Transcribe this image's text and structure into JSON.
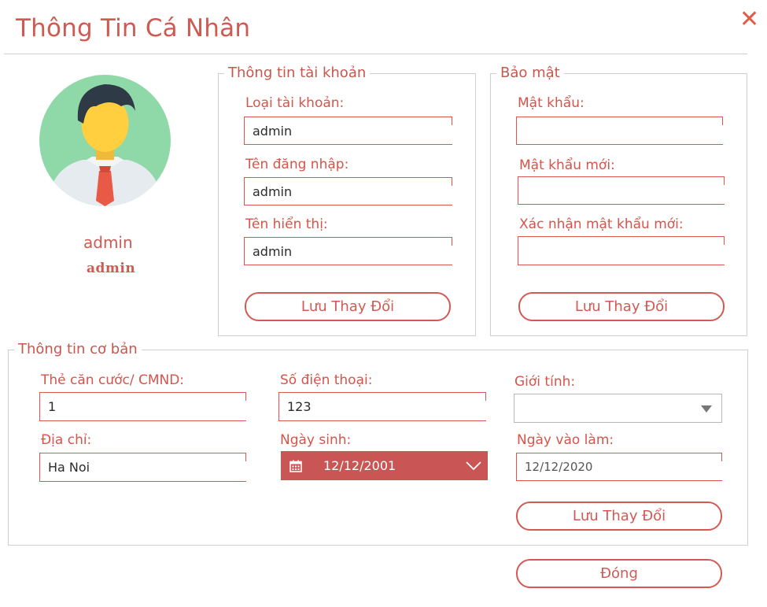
{
  "window": {
    "title": "Thông Tin Cá Nhân",
    "close_symbol": "✕"
  },
  "profile": {
    "name": "admin",
    "role": "admin"
  },
  "account": {
    "legend": "Thông tin tài khoản",
    "type_label": "Loại tài khoản:",
    "type_value": "admin",
    "username_label": "Tên đăng nhập:",
    "username_value": "admin",
    "display_label": "Tên hiển thị:",
    "display_value": "admin",
    "save_label": "Lưu Thay Đổi"
  },
  "security": {
    "legend": "Bảo mật",
    "password_label": "Mật khẩu:",
    "password_value": "",
    "new_password_label": "Mật khẩu mới:",
    "new_password_value": "",
    "confirm_label": "Xác nhận mật khẩu mới:",
    "confirm_value": "",
    "save_label": "Lưu Thay Đổi"
  },
  "basic": {
    "legend": "Thông tin cơ bản",
    "id_label": "Thẻ căn cước/ CMND:",
    "id_value": "1",
    "phone_label": "Số điện thoại:",
    "phone_value": "123",
    "gender_label": "Giới tính:",
    "gender_value": "",
    "address_label": "Địa chỉ:",
    "address_value": "Ha Noi",
    "birth_label": "Ngày sinh:",
    "birth_value": "12/12/2001",
    "start_label": "Ngày vào làm:",
    "start_value": "12/12/2020",
    "save_label": "Lưu Thay Đổi"
  },
  "footer": {
    "close_label": "Đóng"
  },
  "colors": {
    "accent": "#d9574f",
    "date_bg": "#c95655",
    "border": "#cfcfcf"
  },
  "icons": {
    "close": "close-icon",
    "calendar": "calendar-icon",
    "dropdown": "chevron-down-icon",
    "avatar": "avatar-icon"
  }
}
